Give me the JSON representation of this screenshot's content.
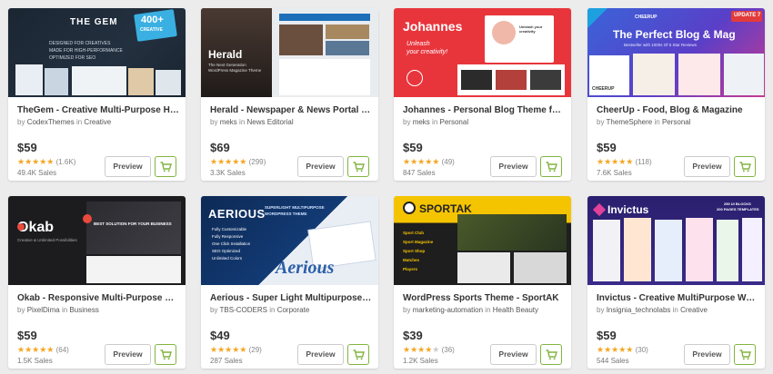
{
  "cards": [
    {
      "title": "TheGem - Creative Multi-Purpose High-Performance WordPress Theme",
      "by": "by",
      "author": "CodexThemes",
      "in_word": "in",
      "category": "Creative",
      "price": "$59",
      "stars": 5,
      "reviews": "(1.6K)",
      "sales": "49.4K Sales",
      "preview": "Preview",
      "thumb": {
        "brand": "THE GEM",
        "badge": "400+",
        "badge_sub": "CREATIVE",
        "line1": "DESIGNED FOR CREATIVES",
        "line2": "MADE FOR HIGH-PERFORMANCE",
        "line3": "OPTIMIZED FOR SEO"
      }
    },
    {
      "title": "Herald - Newspaper & News Portal WordPress Theme",
      "by": "by",
      "author": "meks",
      "in_word": "in",
      "category": "News Editorial",
      "price": "$69",
      "stars": 5,
      "reviews": "(299)",
      "sales": "3.3K Sales",
      "preview": "Preview",
      "thumb": {
        "brand": "Herald",
        "line1": "The Next Generation",
        "line2": "WordPress Magazine Theme"
      }
    },
    {
      "title": "Johannes - Personal Blog Theme for WordPress",
      "by": "by",
      "author": "meks",
      "in_word": "in",
      "category": "Personal",
      "price": "$59",
      "stars": 5,
      "reviews": "(49)",
      "sales": "847 Sales",
      "preview": "Preview",
      "thumb": {
        "brand": "Johannes",
        "line1": "Unleash",
        "line2": "your creativity!",
        "line3": "Unleash your creativity"
      }
    },
    {
      "title": "CheerUp - Food, Blog & Magazine",
      "by": "by",
      "author": "ThemeSphere",
      "in_word": "in",
      "category": "Personal",
      "price": "$59",
      "stars": 5,
      "reviews": "(118)",
      "sales": "7.6K Sales",
      "preview": "Preview",
      "thumb": {
        "brand": "CHEERUP",
        "badge": "UPDATE 7",
        "line1": "The Perfect Blog & Mag",
        "line2": "Bestseller with 1000s Of 5 Star Reviews",
        "line3": "CHEERUP"
      }
    },
    {
      "title": "Okab - Responsive Multi-Purpose WordPress Theme",
      "by": "by",
      "author": "PixelDima",
      "in_word": "in",
      "category": "Business",
      "price": "$59",
      "stars": 5,
      "reviews": "(64)",
      "sales": "1.5K Sales",
      "preview": "Preview",
      "thumb": {
        "brand": "Okab",
        "line1": "Creative & Unlimited Possibilities",
        "line2": "BEST SOLUTION FOR YOUR BUSINESS"
      }
    },
    {
      "title": "Aerious - Super Light Multipurpose WordPress Theme",
      "by": "by",
      "author": "TBS-CODERS",
      "in_word": "in",
      "category": "Corporate",
      "price": "$49",
      "stars": 5,
      "reviews": "(29)",
      "sales": "287 Sales",
      "preview": "Preview",
      "thumb": {
        "brand": "AERIOUS",
        "line1": "SUPERLIGHT MULTIPURPOSE",
        "line2": "WORDPRESS THEME",
        "features": [
          "Fully Customizable",
          "Fully Responsive",
          "One Click Installation",
          "SEO Optimized",
          "Unlimited Colors"
        ],
        "big": "Aerious"
      }
    },
    {
      "title": "WordPress Sports Theme - SportAK",
      "by": "by",
      "author": "marketing-automation",
      "in_word": "in",
      "category": "Health Beauty",
      "price": "$39",
      "stars": 4,
      "reviews": "(36)",
      "sales": "1.2K Sales",
      "preview": "Preview",
      "thumb": {
        "brand": "SPORTAK",
        "features": [
          "Sport Club",
          "Sport Magazine",
          "Sport Shop",
          "Matches",
          "Players"
        ]
      }
    },
    {
      "title": "Invictus - Creative MultiPurpose WordPress Theme",
      "by": "by",
      "author": "Insignia_technolabs",
      "in_word": "in",
      "category": "Creative",
      "price": "$59",
      "stars": 5,
      "reviews": "(30)",
      "sales": "544 Sales",
      "preview": "Preview",
      "thumb": {
        "brand": "Invictus",
        "line1": "250 UI BLOCKS",
        "line2": "200 PAGES TEMPLATES"
      }
    }
  ],
  "colors": {
    "cart_green": "#82b440",
    "star": "#f5a623"
  }
}
